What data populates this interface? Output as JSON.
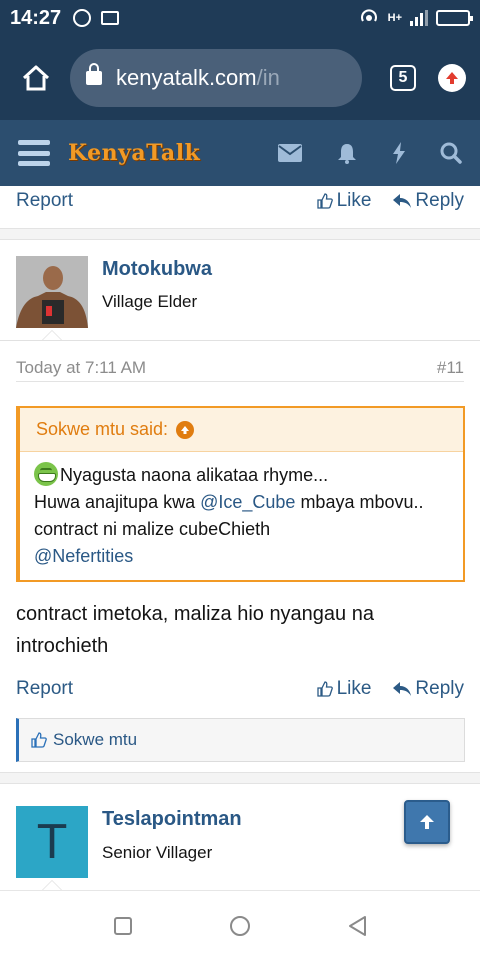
{
  "status_bar": {
    "time": "14:27",
    "icons": [
      "whatsapp-icon",
      "screenshot-icon",
      "hotspot-icon",
      "data-arrows-icon",
      "signal-icon",
      "battery-icon"
    ],
    "network_label": "H+"
  },
  "browser": {
    "url_host": "kenyatalk.com",
    "url_path": "/in",
    "tab_count": "5",
    "icons": [
      "home-icon",
      "lock-icon",
      "tab-switcher-icon",
      "update-icon"
    ]
  },
  "site": {
    "logo_text": "KenyaTalk",
    "nav_icons": [
      "menu-icon",
      "mail-icon",
      "bell-icon",
      "lightning-icon",
      "search-icon"
    ],
    "colors": {
      "header": "#2c4e6f",
      "logo": "#f29a25",
      "link": "#2a5885"
    }
  },
  "prev_post": {
    "report_label": "Report",
    "like_label": "Like",
    "reply_label": "Reply"
  },
  "post": {
    "author": "Motokubwa",
    "author_title": "Village Elder",
    "timestamp": "Today at 7:11 AM",
    "number": "#11",
    "quote": {
      "author_line": "Sokwe mtu said:",
      "line1": "Nyagusta naona alikataa rhyme...",
      "line2_pre": "Huwa anajitupa kwa ",
      "line2_mention": "@Ice_Cube",
      "line2_post": " mbaya mbovu..",
      "line3": "contract ni malize cubeChieth",
      "line4_mention": "@Nefertities"
    },
    "message": "contract imetoka, maliza hio nyangau na introchieth",
    "report_label": "Report",
    "like_label": "Like",
    "reply_label": "Reply",
    "liked_by": "Sokwe mtu"
  },
  "next_post": {
    "author": "Teslapointman",
    "author_title": "Senior Villager",
    "avatar_letter": "T"
  },
  "android_nav": {
    "icons": [
      "recents-icon",
      "home-circle-icon",
      "back-icon"
    ]
  }
}
